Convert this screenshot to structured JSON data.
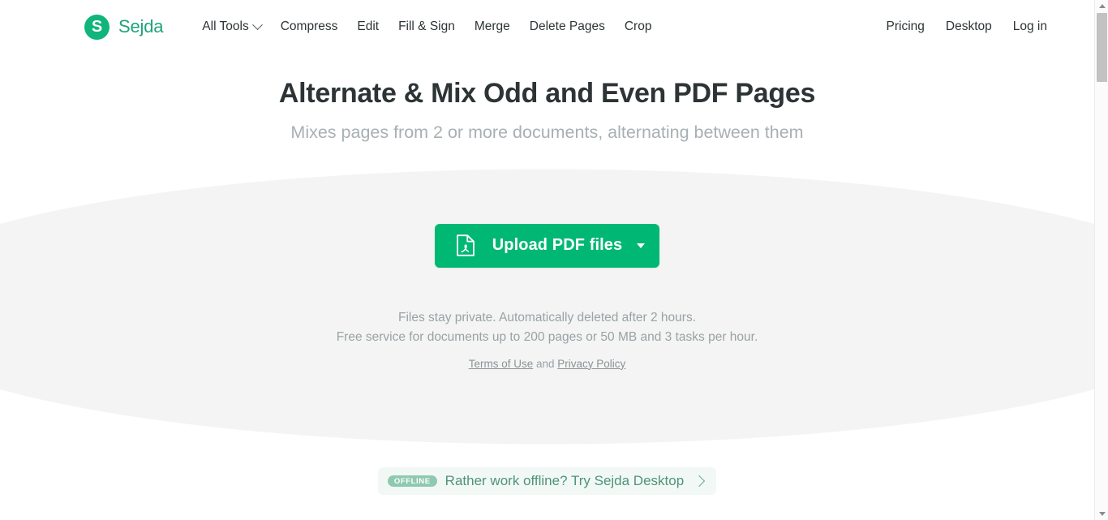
{
  "brand": {
    "mark_letter": "S",
    "name": "Sejda"
  },
  "nav": {
    "left": [
      {
        "label": "All Tools",
        "has_caret": true
      },
      {
        "label": "Compress",
        "has_caret": false
      },
      {
        "label": "Edit",
        "has_caret": false
      },
      {
        "label": "Fill & Sign",
        "has_caret": false
      },
      {
        "label": "Merge",
        "has_caret": false
      },
      {
        "label": "Delete Pages",
        "has_caret": false
      },
      {
        "label": "Crop",
        "has_caret": false
      }
    ],
    "right": [
      {
        "label": "Pricing"
      },
      {
        "label": "Desktop"
      },
      {
        "label": "Log in"
      }
    ]
  },
  "hero": {
    "title": "Alternate & Mix Odd and Even PDF Pages",
    "subtitle": "Mixes pages from 2 or more documents, alternating between them"
  },
  "upload": {
    "icon": "pdf-file-icon",
    "label": "Upload PDF files",
    "caret_icon": "caret-down-icon"
  },
  "disclaimer": {
    "line1": "Files stay private. Automatically deleted after 2 hours.",
    "line2": "Free service for documents up to 200 pages or 50 MB and 3 tasks per hour.",
    "terms_label": "Terms of Use",
    "conjunction": " and ",
    "privacy_label": "Privacy Policy"
  },
  "offline_banner": {
    "badge": "OFFLINE",
    "text": "Rather work offline? Try Sejda Desktop",
    "chevron_icon": "chevron-right-icon"
  },
  "scrollbar": {
    "up_icon": "scroll-up-arrow-icon",
    "down_icon": "scroll-down-arrow-icon"
  },
  "colors": {
    "brand_green": "#1fa37a",
    "logo_green": "#0fb57b",
    "button_green": "#00b873",
    "band_grey": "#f4f4f4",
    "heading": "#2d3436",
    "muted": "#a8b0b3",
    "offline_text": "#4e9478",
    "offline_bg": "#f2f8f5",
    "offline_badge_bg": "#8fc9b0"
  }
}
